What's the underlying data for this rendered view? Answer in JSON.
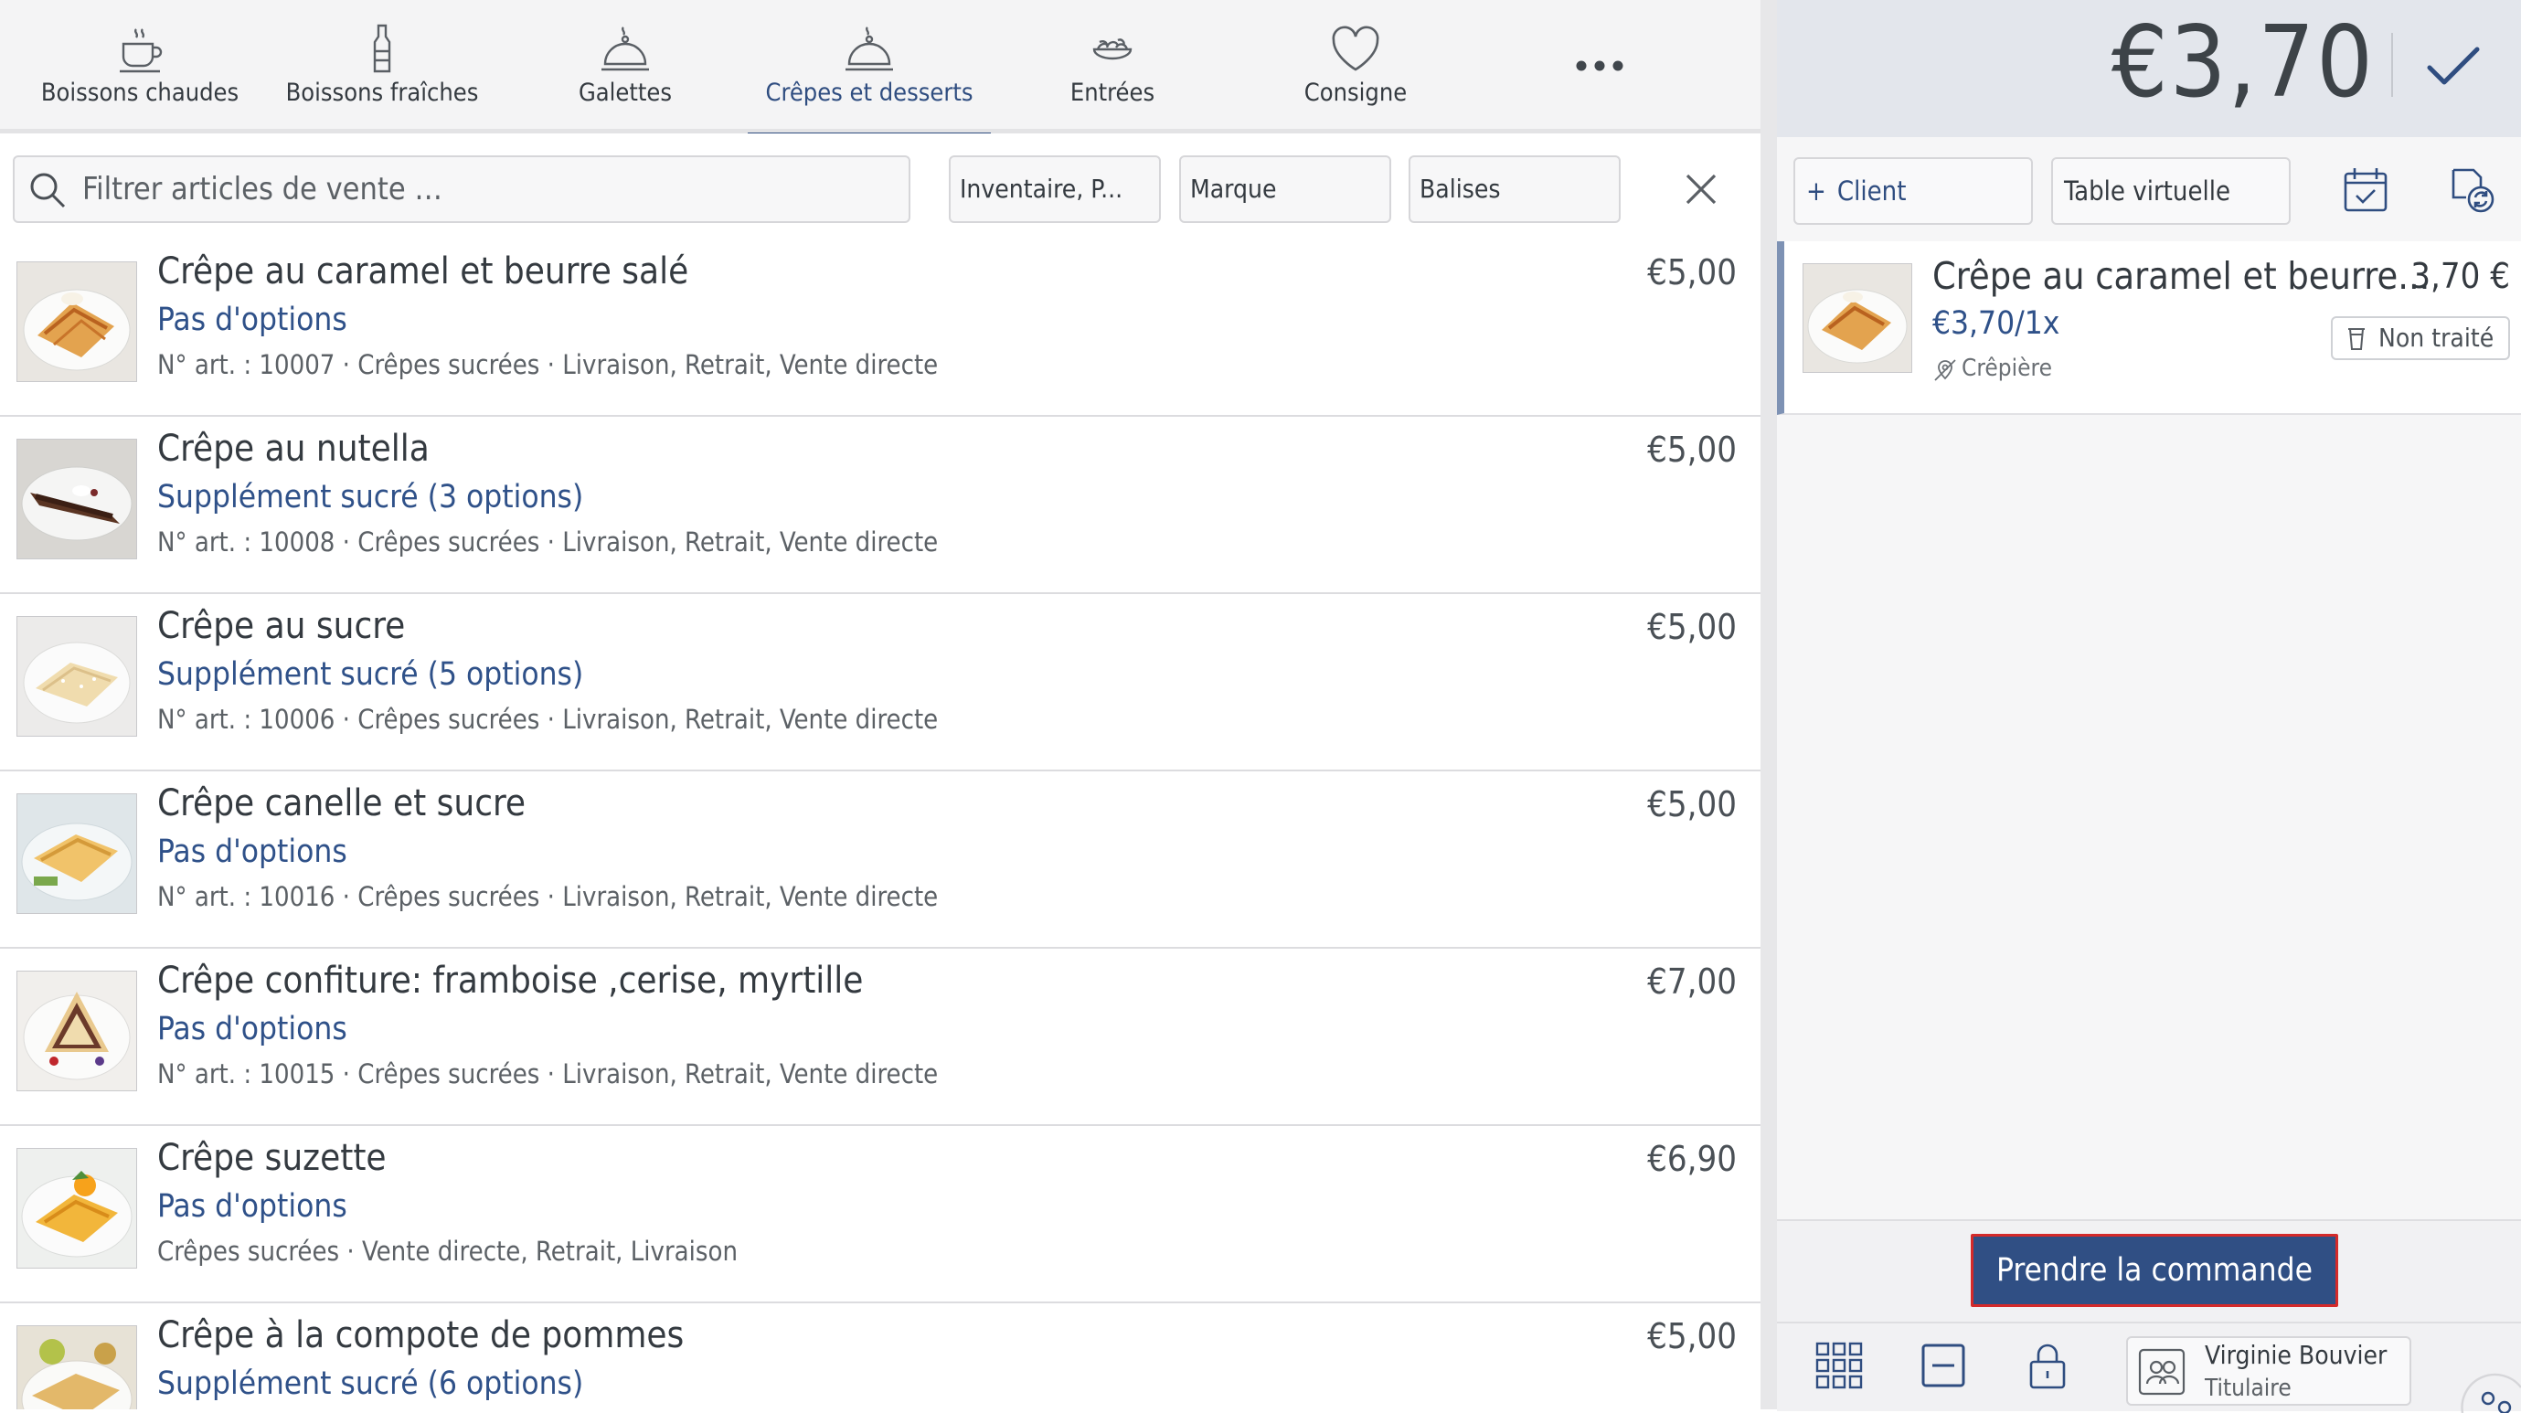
{
  "categories": [
    {
      "label": "Boissons chaudes",
      "icon": "coffee-cup-icon"
    },
    {
      "label": "Boissons fraîches",
      "icon": "bottle-icon"
    },
    {
      "label": "Galettes",
      "icon": "dish-icon"
    },
    {
      "label": "Crêpes et desserts",
      "icon": "cloche-icon",
      "active": true
    },
    {
      "label": "Entrées",
      "icon": "salad-icon"
    },
    {
      "label": "Consigne",
      "icon": "heart-icon"
    }
  ],
  "more_icon": "more-icon",
  "filters": {
    "search_placeholder": "Filtrer articles de vente …",
    "inventory": "Inventaire, P...",
    "brand": "Marque",
    "tags": "Balises"
  },
  "items": [
    {
      "name": "Crêpe au caramel et beurre salé",
      "options": "Pas d'options",
      "meta": "N° art. : 10007 · Crêpes sucrées · Livraison, Retrait, Vente directe",
      "price": "€5,00",
      "thumb": "caramel"
    },
    {
      "name": "Crêpe au nutella",
      "options": "Supplément sucré (3 options)",
      "meta": "N° art. : 10008 · Crêpes sucrées · Livraison, Retrait, Vente directe",
      "price": "€5,00",
      "thumb": "nutella"
    },
    {
      "name": "Crêpe au sucre",
      "options": "Supplément sucré (5 options)",
      "meta": "N° art. : 10006 · Crêpes sucrées · Livraison, Retrait, Vente directe",
      "price": "€5,00",
      "thumb": "sucre"
    },
    {
      "name": "Crêpe canelle et sucre",
      "options": "Pas d'options",
      "meta": "N° art. : 10016 · Crêpes sucrées · Livraison, Retrait, Vente directe",
      "price": "€5,00",
      "thumb": "canelle"
    },
    {
      "name": "Crêpe confiture: framboise ,cerise, myrtille",
      "options": "Pas d'options",
      "meta": "N° art. : 10015 · Crêpes sucrées · Livraison, Retrait, Vente directe",
      "price": "€7,00",
      "thumb": "confiture"
    },
    {
      "name": "Crêpe suzette",
      "options": "Pas d'options",
      "meta": "Crêpes sucrées · Vente directe, Retrait, Livraison",
      "price": "€6,90",
      "thumb": "suzette"
    },
    {
      "name": "Crêpe à la compote de pommes",
      "options": "Supplément sucré (6 options)",
      "meta": "",
      "price": "€5,00",
      "thumb": "compote"
    }
  ],
  "order": {
    "total": "€3,70",
    "client_label": "Client",
    "table_label": "Table virtuelle",
    "line": {
      "name": "Crêpe au caramel et beurre...",
      "price": "3,70 €",
      "unit": "€3,70/1x",
      "status": "Non traité",
      "station": "Crêpière"
    },
    "submit_label": "Prendre la commande",
    "user": {
      "name": "Virginie Bouvier",
      "role": "Titulaire"
    }
  },
  "colors": {
    "accent": "#2f4d80",
    "submit_border": "#d42a2a",
    "link_blue": "#2f5189"
  }
}
